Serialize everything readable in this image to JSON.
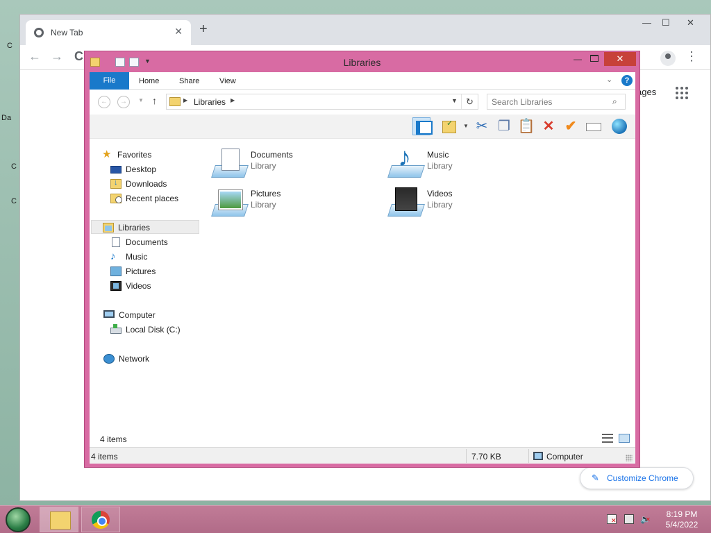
{
  "desktop": {
    "fragments": [
      "C",
      "Da",
      "C",
      "C"
    ]
  },
  "chrome": {
    "tab_title": "New Tab",
    "tab_close": "✕",
    "new_tab": "+",
    "win_min": "—",
    "win_max": "☐",
    "win_close": "✕",
    "back": "←",
    "forward": "→",
    "reload": "C",
    "menu": "⋮",
    "images_link": "ages",
    "customize_label": "Customize Chrome",
    "customize_icon": "pencil-icon"
  },
  "explorer": {
    "title": "Libraries",
    "min": "—",
    "close": "✕",
    "ribbon": {
      "file": "File",
      "tabs": [
        "Home",
        "Share",
        "View"
      ],
      "chevron": "⌄",
      "help": "?"
    },
    "address": {
      "back": "←",
      "forward": "→",
      "up": "↑",
      "crumb": "Libraries",
      "refresh": "↻",
      "search_placeholder": "Search Libraries",
      "search_icon": "🔍"
    },
    "toolbar": {
      "cut": "✂",
      "copy": "❐",
      "paste": "📋",
      "delete": "✕",
      "properties": "✔"
    },
    "nav": {
      "favorites": "Favorites",
      "favorites_items": [
        "Desktop",
        "Downloads",
        "Recent places"
      ],
      "libraries": "Libraries",
      "libraries_items": [
        "Documents",
        "Music",
        "Pictures",
        "Videos"
      ],
      "computer": "Computer",
      "computer_items": [
        "Local Disk (C:)"
      ],
      "network": "Network"
    },
    "libraries": [
      {
        "name": "Documents",
        "type": "Library",
        "icon": "documents-library-icon"
      },
      {
        "name": "Music",
        "type": "Library",
        "icon": "music-library-icon"
      },
      {
        "name": "Pictures",
        "type": "Library",
        "icon": "pictures-library-icon"
      },
      {
        "name": "Videos",
        "type": "Library",
        "icon": "videos-library-icon"
      }
    ],
    "item_count": "4 items",
    "status": {
      "items": "4 items",
      "size": "7.70 KB",
      "location": "Computer"
    }
  },
  "taskbar": {
    "time": "8:19 PM",
    "date": "5/4/2022",
    "volume_icon": "🔈"
  },
  "colors": {
    "explorer_frame": "#d86ba3",
    "file_tab": "#1979ca",
    "close_button": "#c7413a",
    "taskbar": "#b9738f",
    "chrome_accent": "#1a73e8"
  }
}
